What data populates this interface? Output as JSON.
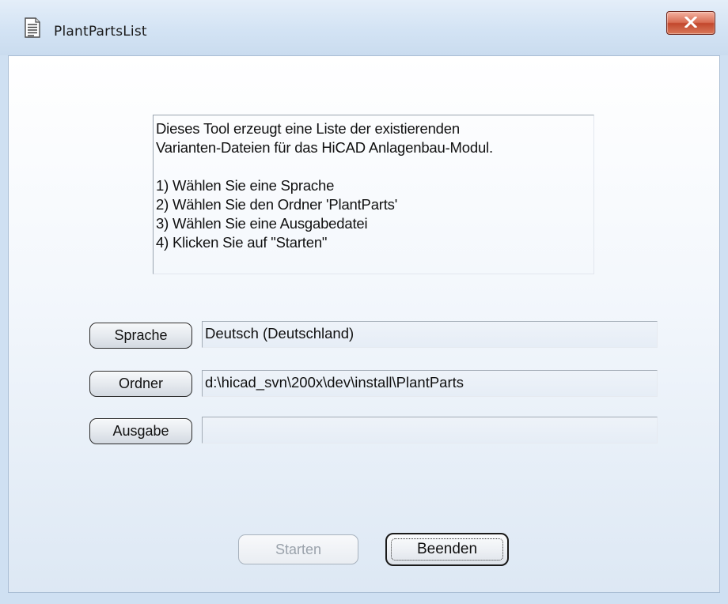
{
  "window": {
    "title": "PlantPartsList",
    "close_label": "x"
  },
  "info": {
    "lines": [
      "Dieses Tool erzeugt eine Liste der existierenden",
      "Varianten-Dateien für das HiCAD Anlagenbau-Modul.",
      "",
      "1) Wählen Sie eine Sprache",
      "2) Wählen Sie den Ordner 'PlantParts'",
      "3) Wählen Sie eine Ausgabedatei",
      "4) Klicken Sie auf \"Starten\""
    ]
  },
  "rows": {
    "language": {
      "button_label": "Sprache",
      "value": "Deutsch (Deutschland)"
    },
    "folder": {
      "button_label": "Ordner",
      "value": "d:\\hicad_svn\\200x\\dev\\install\\PlantParts"
    },
    "output": {
      "button_label": "Ausgabe",
      "value": ""
    }
  },
  "actions": {
    "start_label": "Starten",
    "start_enabled": false,
    "quit_label": "Beenden"
  },
  "icons": {
    "app": "document-icon",
    "close": "close-icon"
  }
}
